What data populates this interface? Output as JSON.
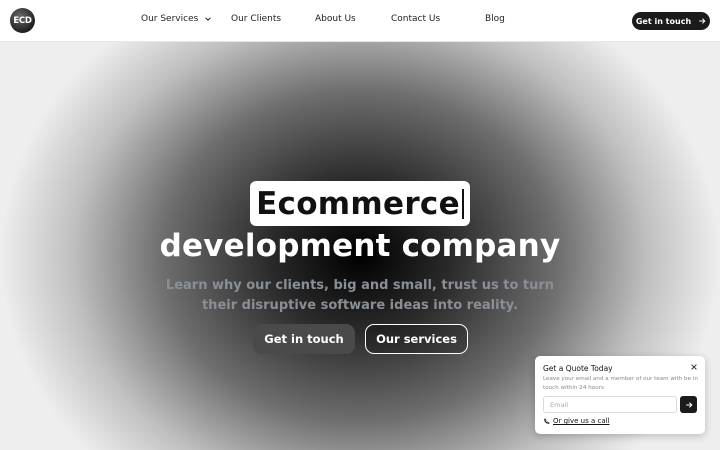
{
  "header": {
    "logo_text": "ECD",
    "nav": {
      "services": "Our Services",
      "clients": "Our Clients",
      "about": "About Us",
      "contact": "Contact Us",
      "blog": "Blog"
    },
    "cta_label": "Get in touch"
  },
  "hero": {
    "typed_word": "Ecommerce",
    "title": "development company",
    "subtitle": "Learn why our clients, big and small, trust us to turn their disruptive software ideas into reality.",
    "primary_button": "Get in touch",
    "secondary_button": "Our services"
  },
  "quote_widget": {
    "title": "Get a Quote Today",
    "description": "Leave your email and a member of our team with be in touch within 24 hours",
    "email_placeholder": "Email",
    "email_value": "",
    "call_link": "Or give us a call"
  },
  "icons": {
    "nav_dropdown": "chevron-down-icon",
    "header_cta": "arrow-right-icon",
    "quote_close": "close-icon",
    "quote_submit": "arrow-right-icon",
    "quote_call": "phone-icon"
  },
  "colors": {
    "accent": "#1b1b1b",
    "hero_center": "#000000",
    "subtitle": "#8a8f96"
  }
}
